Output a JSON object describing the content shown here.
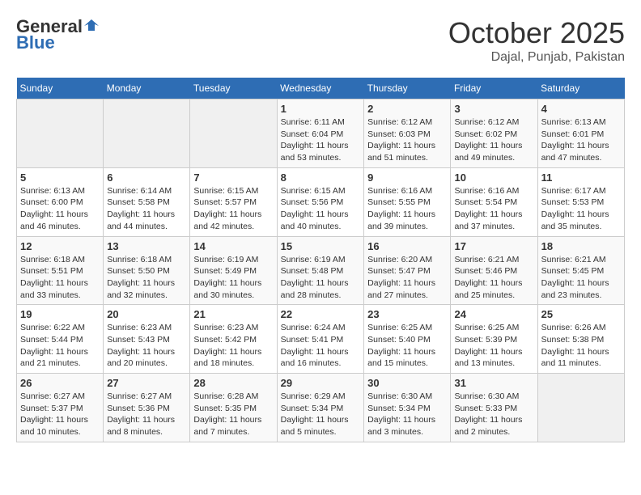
{
  "header": {
    "logo_general": "General",
    "logo_blue": "Blue",
    "title": "October 2025",
    "subtitle": "Dajal, Punjab, Pakistan"
  },
  "calendar": {
    "days_of_week": [
      "Sunday",
      "Monday",
      "Tuesday",
      "Wednesday",
      "Thursday",
      "Friday",
      "Saturday"
    ],
    "weeks": [
      [
        {
          "day": "",
          "info": ""
        },
        {
          "day": "",
          "info": ""
        },
        {
          "day": "",
          "info": ""
        },
        {
          "day": "1",
          "info": "Sunrise: 6:11 AM\nSunset: 6:04 PM\nDaylight: 11 hours and 53 minutes."
        },
        {
          "day": "2",
          "info": "Sunrise: 6:12 AM\nSunset: 6:03 PM\nDaylight: 11 hours and 51 minutes."
        },
        {
          "day": "3",
          "info": "Sunrise: 6:12 AM\nSunset: 6:02 PM\nDaylight: 11 hours and 49 minutes."
        },
        {
          "day": "4",
          "info": "Sunrise: 6:13 AM\nSunset: 6:01 PM\nDaylight: 11 hours and 47 minutes."
        }
      ],
      [
        {
          "day": "5",
          "info": "Sunrise: 6:13 AM\nSunset: 6:00 PM\nDaylight: 11 hours and 46 minutes."
        },
        {
          "day": "6",
          "info": "Sunrise: 6:14 AM\nSunset: 5:58 PM\nDaylight: 11 hours and 44 minutes."
        },
        {
          "day": "7",
          "info": "Sunrise: 6:15 AM\nSunset: 5:57 PM\nDaylight: 11 hours and 42 minutes."
        },
        {
          "day": "8",
          "info": "Sunrise: 6:15 AM\nSunset: 5:56 PM\nDaylight: 11 hours and 40 minutes."
        },
        {
          "day": "9",
          "info": "Sunrise: 6:16 AM\nSunset: 5:55 PM\nDaylight: 11 hours and 39 minutes."
        },
        {
          "day": "10",
          "info": "Sunrise: 6:16 AM\nSunset: 5:54 PM\nDaylight: 11 hours and 37 minutes."
        },
        {
          "day": "11",
          "info": "Sunrise: 6:17 AM\nSunset: 5:53 PM\nDaylight: 11 hours and 35 minutes."
        }
      ],
      [
        {
          "day": "12",
          "info": "Sunrise: 6:18 AM\nSunset: 5:51 PM\nDaylight: 11 hours and 33 minutes."
        },
        {
          "day": "13",
          "info": "Sunrise: 6:18 AM\nSunset: 5:50 PM\nDaylight: 11 hours and 32 minutes."
        },
        {
          "day": "14",
          "info": "Sunrise: 6:19 AM\nSunset: 5:49 PM\nDaylight: 11 hours and 30 minutes."
        },
        {
          "day": "15",
          "info": "Sunrise: 6:19 AM\nSunset: 5:48 PM\nDaylight: 11 hours and 28 minutes."
        },
        {
          "day": "16",
          "info": "Sunrise: 6:20 AM\nSunset: 5:47 PM\nDaylight: 11 hours and 27 minutes."
        },
        {
          "day": "17",
          "info": "Sunrise: 6:21 AM\nSunset: 5:46 PM\nDaylight: 11 hours and 25 minutes."
        },
        {
          "day": "18",
          "info": "Sunrise: 6:21 AM\nSunset: 5:45 PM\nDaylight: 11 hours and 23 minutes."
        }
      ],
      [
        {
          "day": "19",
          "info": "Sunrise: 6:22 AM\nSunset: 5:44 PM\nDaylight: 11 hours and 21 minutes."
        },
        {
          "day": "20",
          "info": "Sunrise: 6:23 AM\nSunset: 5:43 PM\nDaylight: 11 hours and 20 minutes."
        },
        {
          "day": "21",
          "info": "Sunrise: 6:23 AM\nSunset: 5:42 PM\nDaylight: 11 hours and 18 minutes."
        },
        {
          "day": "22",
          "info": "Sunrise: 6:24 AM\nSunset: 5:41 PM\nDaylight: 11 hours and 16 minutes."
        },
        {
          "day": "23",
          "info": "Sunrise: 6:25 AM\nSunset: 5:40 PM\nDaylight: 11 hours and 15 minutes."
        },
        {
          "day": "24",
          "info": "Sunrise: 6:25 AM\nSunset: 5:39 PM\nDaylight: 11 hours and 13 minutes."
        },
        {
          "day": "25",
          "info": "Sunrise: 6:26 AM\nSunset: 5:38 PM\nDaylight: 11 hours and 11 minutes."
        }
      ],
      [
        {
          "day": "26",
          "info": "Sunrise: 6:27 AM\nSunset: 5:37 PM\nDaylight: 11 hours and 10 minutes."
        },
        {
          "day": "27",
          "info": "Sunrise: 6:27 AM\nSunset: 5:36 PM\nDaylight: 11 hours and 8 minutes."
        },
        {
          "day": "28",
          "info": "Sunrise: 6:28 AM\nSunset: 5:35 PM\nDaylight: 11 hours and 7 minutes."
        },
        {
          "day": "29",
          "info": "Sunrise: 6:29 AM\nSunset: 5:34 PM\nDaylight: 11 hours and 5 minutes."
        },
        {
          "day": "30",
          "info": "Sunrise: 6:30 AM\nSunset: 5:34 PM\nDaylight: 11 hours and 3 minutes."
        },
        {
          "day": "31",
          "info": "Sunrise: 6:30 AM\nSunset: 5:33 PM\nDaylight: 11 hours and 2 minutes."
        },
        {
          "day": "",
          "info": ""
        }
      ]
    ]
  }
}
